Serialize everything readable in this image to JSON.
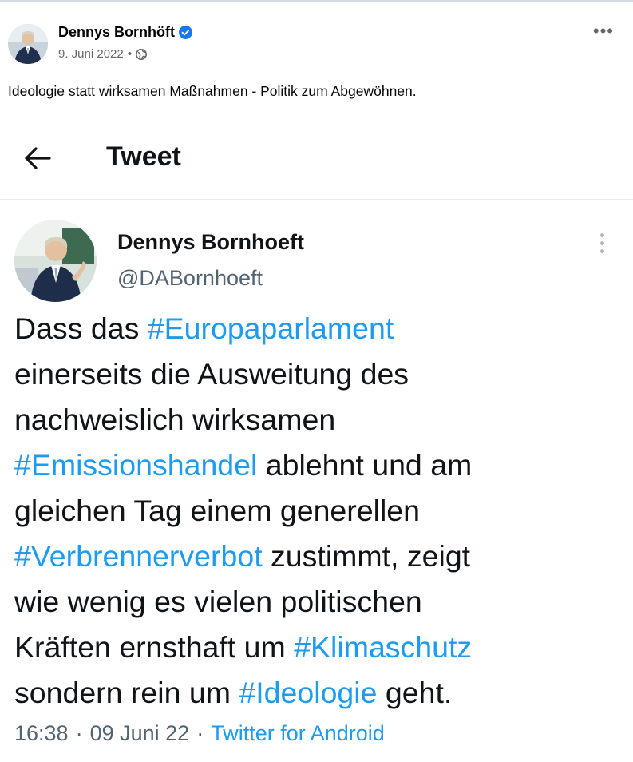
{
  "post": {
    "author": "Dennys Bornhöft",
    "date": "9. Juni 2022",
    "dot": "•",
    "more": "•••",
    "caption": "Ideologie statt wirksamen Maßnahmen - Politik zum Abgewöhnen."
  },
  "tweet": {
    "bar_title": "Tweet",
    "name": "Dennys Bornhoeft",
    "handle": "@DABornhoeft",
    "lines": [
      [
        {
          "t": "Dass das "
        },
        {
          "t": "#Europaparlament",
          "tag": true
        }
      ],
      [
        {
          "t": "einerseits die Ausweitung des"
        }
      ],
      [
        {
          "t": "nachweislich wirksamen"
        }
      ],
      [
        {
          "t": "#Emissionshandel",
          "tag": true
        },
        {
          "t": " ablehnt und am"
        }
      ],
      [
        {
          "t": "gleichen Tag einem generellen"
        }
      ],
      [
        {
          "t": "#Verbrennerverbot",
          "tag": true
        },
        {
          "t": " zustimmt, zeigt"
        }
      ],
      [
        {
          "t": "wie wenig es vielen politischen"
        }
      ],
      [
        {
          "t": "Kräften ernsthaft um "
        },
        {
          "t": "#Klimaschutz",
          "tag": true
        }
      ],
      [
        {
          "t": "sondern rein um "
        },
        {
          "t": "#Ideologie",
          "tag": true
        },
        {
          "t": " geht."
        }
      ]
    ],
    "time": "16:38",
    "sep": "·",
    "date": "09 Juni 22",
    "source": "Twitter for Android"
  },
  "colors": {
    "hashtag": "#1d9bf0",
    "verified": "#1877f2",
    "secondary_text": "#536471"
  }
}
